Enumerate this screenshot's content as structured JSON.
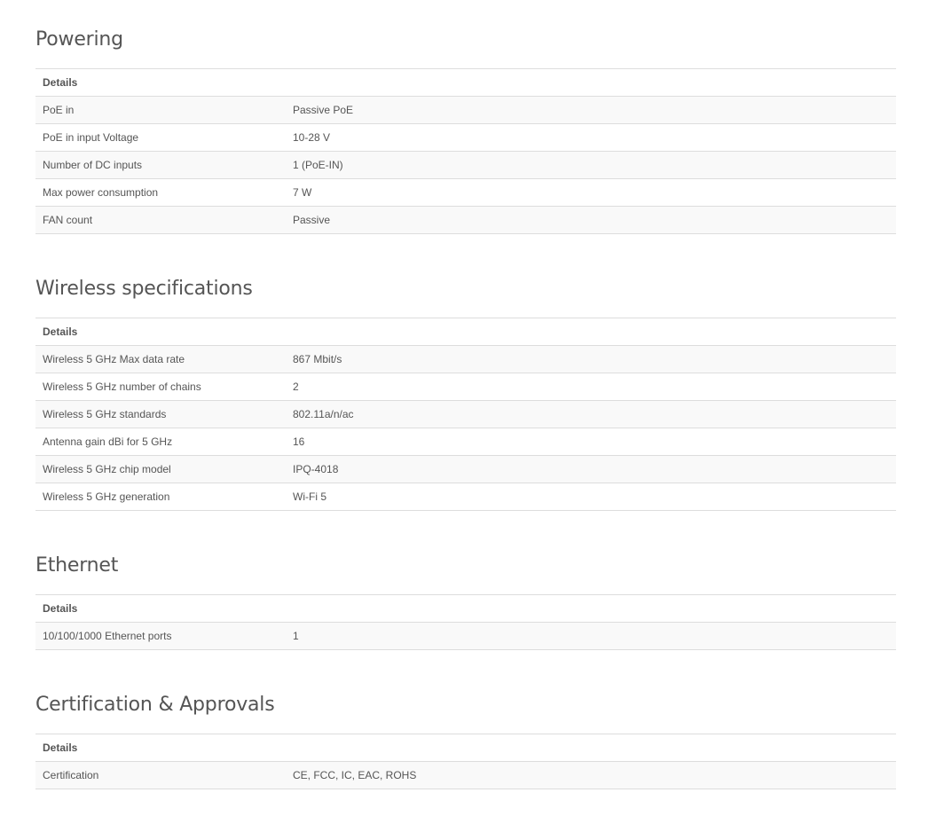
{
  "powering": {
    "title": "Powering",
    "header": "Details",
    "rows": [
      {
        "label": "PoE in",
        "value": "Passive PoE"
      },
      {
        "label": "PoE in input Voltage",
        "value": "10-28 V"
      },
      {
        "label": "Number of DC inputs",
        "value": "1 (PoE-IN)"
      },
      {
        "label": "Max power consumption",
        "value": "7 W"
      },
      {
        "label": "FAN count",
        "value": "Passive"
      }
    ]
  },
  "wireless": {
    "title": "Wireless specifications",
    "header": "Details",
    "rows": [
      {
        "label": "Wireless 5 GHz Max data rate",
        "value": "867 Mbit/s"
      },
      {
        "label": "Wireless 5 GHz number of chains",
        "value": "2"
      },
      {
        "label": "Wireless 5 GHz standards",
        "value": "802.11a/n/ac"
      },
      {
        "label": "Antenna gain dBi for 5 GHz",
        "value": "16"
      },
      {
        "label": "Wireless 5 GHz chip model",
        "value": "IPQ-4018"
      },
      {
        "label": "Wireless 5 GHz generation",
        "value": "Wi-Fi 5"
      }
    ]
  },
  "ethernet": {
    "title": "Ethernet",
    "header": "Details",
    "rows": [
      {
        "label": "10/100/1000 Ethernet ports",
        "value": "1"
      }
    ]
  },
  "certification": {
    "title": "Certification & Approvals",
    "header": "Details",
    "rows": [
      {
        "label": "Certification",
        "value": "CE, FCC, IC, EAC, ROHS"
      }
    ]
  }
}
